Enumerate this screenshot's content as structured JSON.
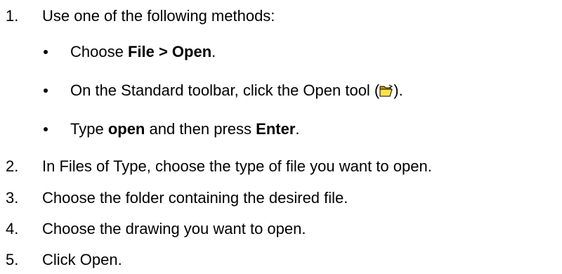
{
  "steps": [
    {
      "number": "1.",
      "text": "Use one of the following methods:"
    },
    {
      "number": "2.",
      "text": "In Files of Type, choose the type of file you want to open."
    },
    {
      "number": "3.",
      "text": "Choose the folder containing the desired file."
    },
    {
      "number": "4.",
      "text": "Choose the drawing you want to open."
    },
    {
      "number": "5.",
      "text": "Click Open."
    }
  ],
  "methods": {
    "m1": {
      "pre": "Choose ",
      "bold": "File > Open",
      "post": "."
    },
    "m2": {
      "pre": "On the Standard toolbar, click the Open tool (",
      "icon": "open-folder-icon",
      "post": ")."
    },
    "m3": {
      "pre": "Type ",
      "bold1": "open",
      "mid": " and then press ",
      "bold2": "Enter",
      "post": "."
    }
  }
}
